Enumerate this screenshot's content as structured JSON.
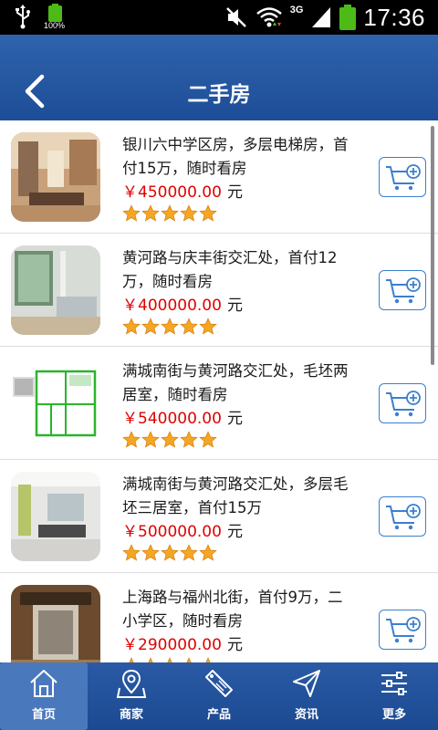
{
  "status_bar": {
    "battery_small_text": "100%",
    "network_label": "3G",
    "time": "17:36"
  },
  "header": {
    "title": "二手房"
  },
  "listings": [
    {
      "description": "银川六中学区房，多层电梯房，首付15万，随时看房",
      "price": "￥450000.00",
      "unit": "元",
      "rating": 5
    },
    {
      "description": "黄河路与庆丰街交汇处，首付12万，随时看房",
      "price": "￥400000.00",
      "unit": "元",
      "rating": 5
    },
    {
      "description": "满城南街与黄河路交汇处，毛坯两居室，随时看房",
      "price": "￥540000.00",
      "unit": "元",
      "rating": 5
    },
    {
      "description": "满城南街与黄河路交汇处，多层毛坯三居室，首付15万",
      "price": "￥500000.00",
      "unit": "元",
      "rating": 5
    },
    {
      "description": "上海路与福州北街，首付9万，二小学区，随时看房",
      "price": "￥290000.00",
      "unit": "元",
      "rating": 5
    }
  ],
  "nav": [
    {
      "label": "首页",
      "icon": "home-icon",
      "active": true
    },
    {
      "label": "商家",
      "icon": "map-icon",
      "active": false
    },
    {
      "label": "产品",
      "icon": "sale-tag-icon",
      "active": false
    },
    {
      "label": "资讯",
      "icon": "send-icon",
      "active": false
    },
    {
      "label": "更多",
      "icon": "sliders-icon",
      "active": false
    }
  ],
  "colors": {
    "header_blue": "#2557a3",
    "price_red": "#e00000",
    "cart_blue": "#3b7fcf",
    "star_orange": "#f5a623"
  }
}
